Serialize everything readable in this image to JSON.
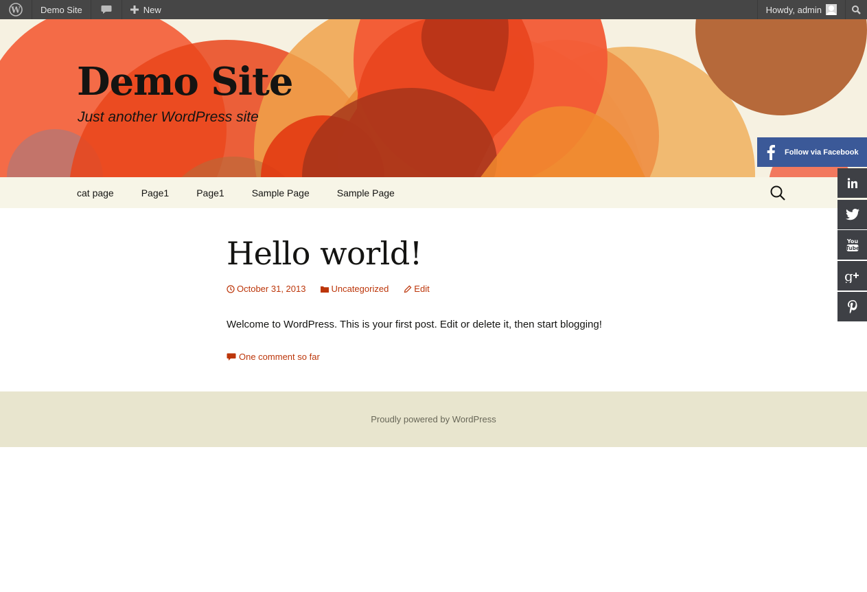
{
  "adminbar": {
    "site_name": "Demo Site",
    "new_label": "New",
    "greeting": "Howdy, admin",
    "icons": [
      "wordpress-icon",
      "comment-bubble-icon",
      "plus-icon",
      "avatar",
      "search-icon"
    ]
  },
  "header": {
    "site_title": "Demo Site",
    "tagline": "Just another WordPress site"
  },
  "nav": {
    "items": [
      {
        "label": "cat page"
      },
      {
        "label": "Page1"
      },
      {
        "label": "Page1"
      },
      {
        "label": "Sample Page"
      },
      {
        "label": "Sample Page"
      }
    ]
  },
  "post": {
    "title": "Hello world!",
    "date": "October 31, 2013",
    "category": "Uncategorized",
    "edit_label": "Edit",
    "content": "Welcome to WordPress. This is your first post. Edit or delete it, then start blogging!",
    "comments_link": "One comment so far"
  },
  "footer": {
    "text": "Proudly powered by WordPress"
  },
  "social": {
    "follow_label": "Follow via Facebook",
    "buttons": [
      "linkedin-icon",
      "twitter-icon",
      "youtube-icon",
      "google-plus-icon",
      "pinterest-icon"
    ]
  },
  "colors": {
    "accent": "#bc360a",
    "admin_bar": "#464646",
    "nav_bg": "#f7f5e7",
    "footer_bg": "#e8e5ce",
    "facebook_blue": "#3b5998",
    "social_btn": "#3e4045"
  }
}
